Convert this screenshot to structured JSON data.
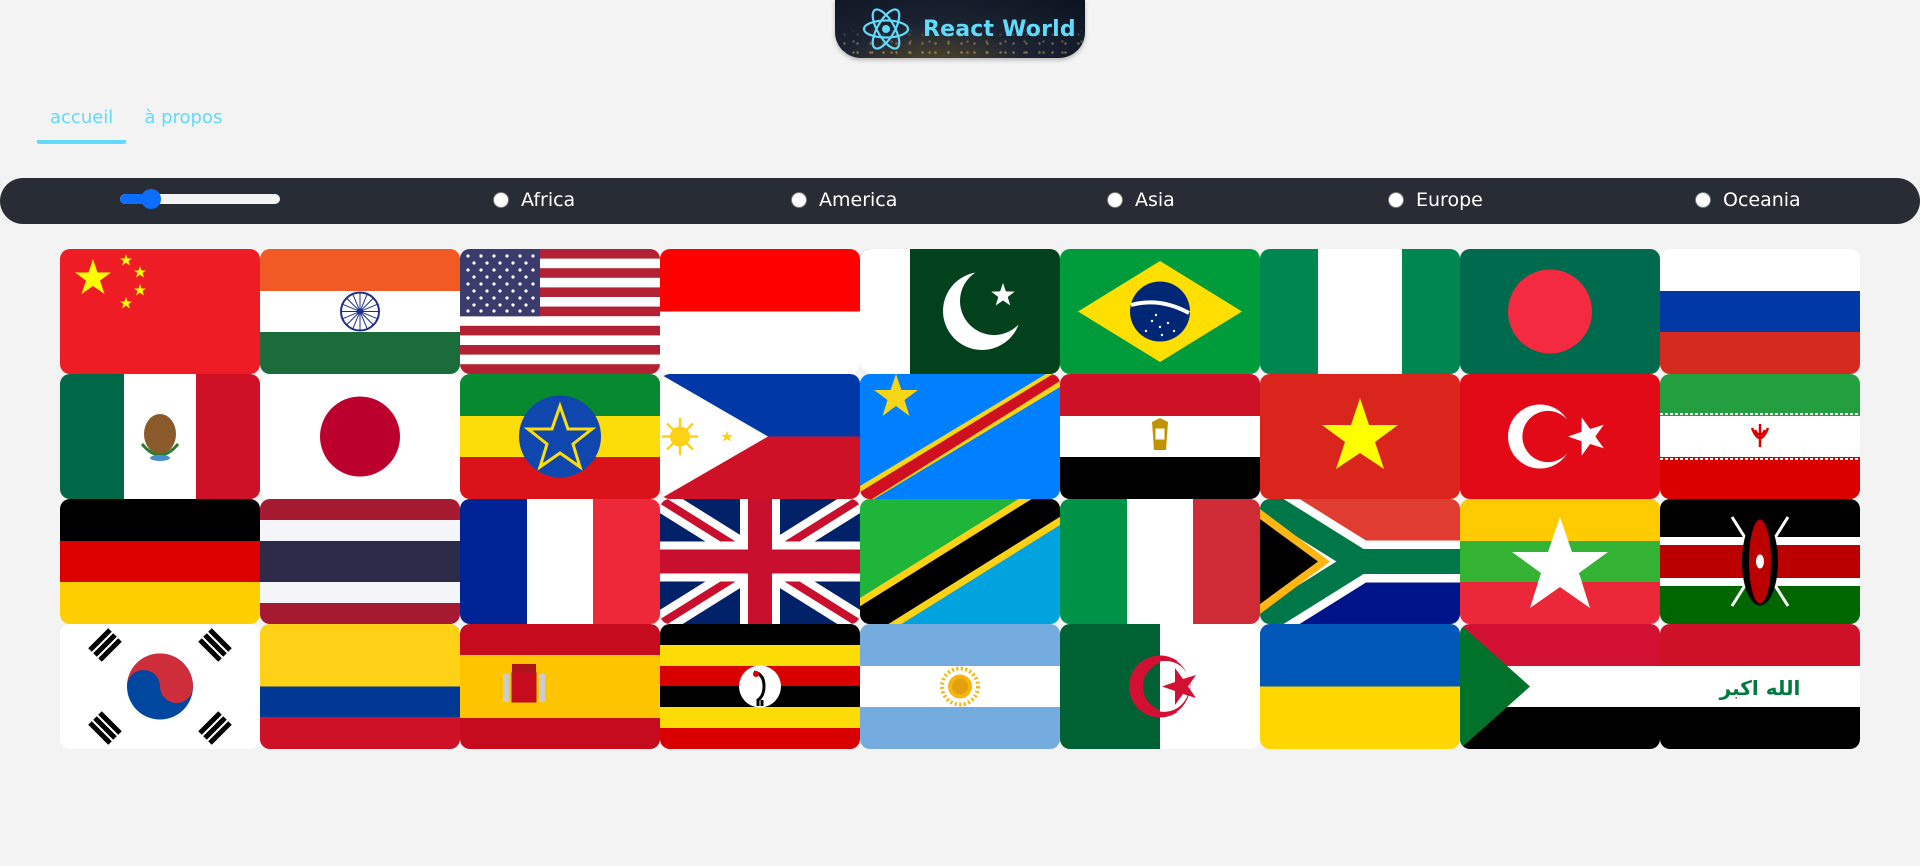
{
  "logo": {
    "text": "React World",
    "icon": "react-atom-icon",
    "accent": "#61dafb"
  },
  "nav": {
    "items": [
      {
        "label": "accueil",
        "active": true
      },
      {
        "label": "à propos",
        "active": false
      }
    ]
  },
  "filter": {
    "range_value_fraction": 0.15,
    "regions": [
      {
        "label": "Africa",
        "checked": false
      },
      {
        "label": "America",
        "checked": false
      },
      {
        "label": "Asia",
        "checked": false
      },
      {
        "label": "Europe",
        "checked": false
      },
      {
        "label": "Oceania",
        "checked": false
      }
    ]
  },
  "flags": [
    "china",
    "india",
    "united-states",
    "indonesia",
    "pakistan",
    "brazil",
    "nigeria",
    "bangladesh",
    "russia",
    "mexico",
    "japan",
    "ethiopia",
    "philippines",
    "dr-congo",
    "egypt",
    "vietnam",
    "turkey",
    "iran",
    "germany",
    "thailand",
    "france",
    "united-kingdom",
    "tanzania",
    "italy",
    "south-africa",
    "myanmar",
    "kenya",
    "south-korea",
    "colombia",
    "spain",
    "uganda",
    "argentina",
    "algeria",
    "ukraine",
    "sudan",
    "iraq"
  ],
  "iraq_flag_script": "الله اكبر"
}
